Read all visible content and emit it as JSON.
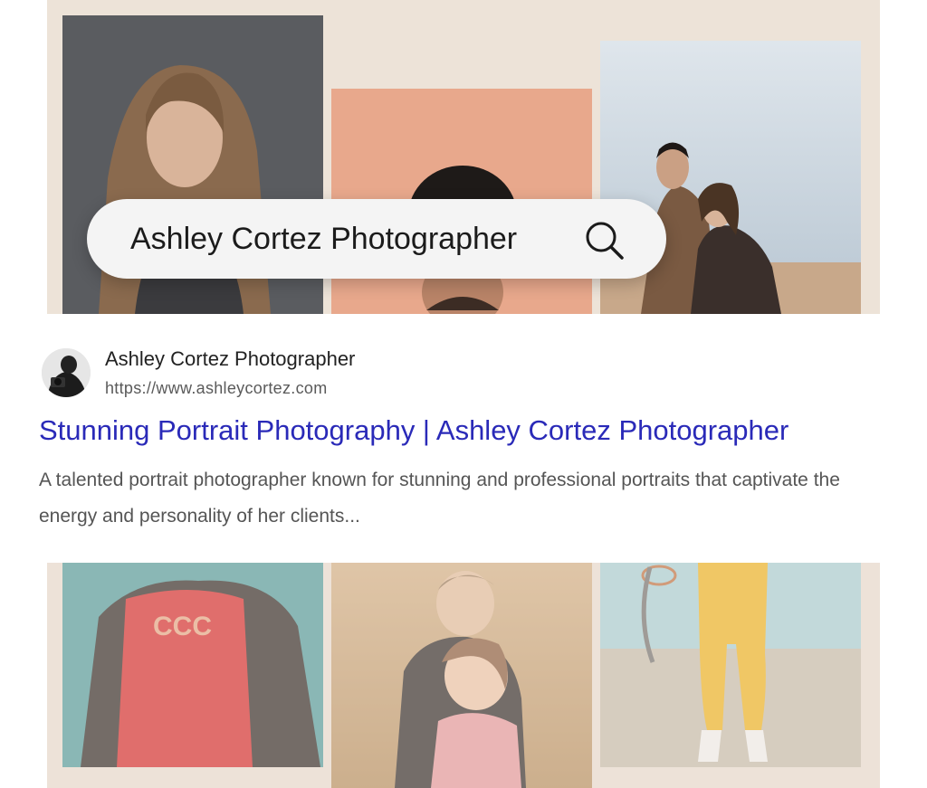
{
  "search": {
    "query": "Ashley Cortez Photographer",
    "icon": "search-icon"
  },
  "result": {
    "site_name": "Ashley Cortez Photographer",
    "url": "https://www.ashleycortez.com",
    "title": "Stunning Portrait Photography | Ashley Cortez Photographer",
    "snippet": "A talented portrait photographer known for stunning and professional portraits that captivate the energy and personality of her clients..."
  },
  "colors": {
    "background": "#ede3d8",
    "link": "#2a2ab8",
    "search_bar": "#f4f4f4"
  }
}
